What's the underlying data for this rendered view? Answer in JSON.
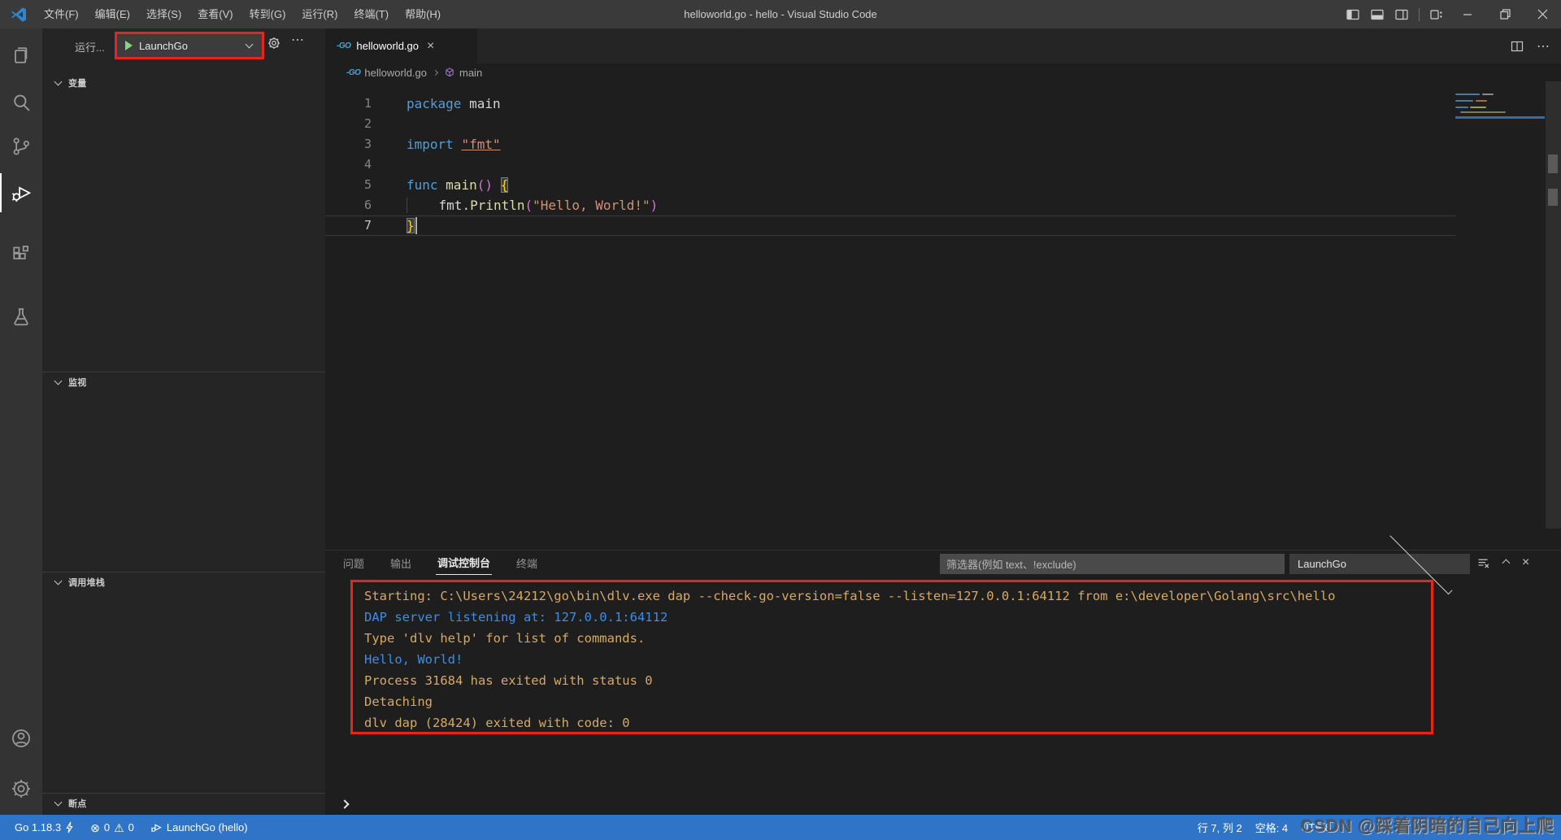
{
  "titlebar": {
    "title": "helloworld.go - hello - Visual Studio Code",
    "menus": [
      "文件(F)",
      "编辑(E)",
      "选择(S)",
      "查看(V)",
      "转到(G)",
      "运行(R)",
      "终端(T)",
      "帮助(H)"
    ]
  },
  "sidebar": {
    "run_label": "运行...",
    "launch_config": "LaunchGo",
    "sections": {
      "variables": "变量",
      "watch": "监视",
      "call_stack": "调用堆栈",
      "breakpoints": "断点"
    }
  },
  "editor": {
    "tab": "helloworld.go",
    "breadcrumb_file": "helloworld.go",
    "breadcrumb_symbol": "main",
    "lines": [
      {
        "n": "1",
        "tokens": [
          {
            "t": "package",
            "c": "kw"
          },
          {
            "t": " ",
            "c": "pl"
          },
          {
            "t": "main",
            "c": "pl"
          }
        ]
      },
      {
        "n": "2",
        "tokens": []
      },
      {
        "n": "3",
        "tokens": [
          {
            "t": "import",
            "c": "kw"
          },
          {
            "t": " ",
            "c": "pl"
          },
          {
            "t": "\"fmt\"",
            "c": "str link"
          }
        ]
      },
      {
        "n": "4",
        "tokens": []
      },
      {
        "n": "5",
        "tokens": [
          {
            "t": "func",
            "c": "kw"
          },
          {
            "t": " ",
            "c": "pl"
          },
          {
            "t": "main",
            "c": "fn"
          },
          {
            "t": "(",
            "c": "br1"
          },
          {
            "t": ")",
            "c": "br1"
          },
          {
            "t": " ",
            "c": "pl"
          },
          {
            "t": "{",
            "c": "brace match"
          }
        ]
      },
      {
        "n": "6",
        "tokens": [
          {
            "t": "    ",
            "c": "pl indent"
          },
          {
            "t": "fmt",
            "c": "pl"
          },
          {
            "t": ".",
            "c": "pl"
          },
          {
            "t": "Println",
            "c": "fn"
          },
          {
            "t": "(",
            "c": "br1"
          },
          {
            "t": "\"Hello, World!\"",
            "c": "str"
          },
          {
            "t": ")",
            "c": "br1"
          }
        ]
      },
      {
        "n": "7",
        "tokens": [
          {
            "t": "}",
            "c": "brace match"
          }
        ]
      }
    ]
  },
  "panel": {
    "tabs": [
      {
        "label": "问题",
        "active": false
      },
      {
        "label": "输出",
        "active": false
      },
      {
        "label": "调试控制台",
        "active": true
      },
      {
        "label": "终端",
        "active": false
      }
    ],
    "filter_placeholder": "筛选器(例如 text、!exclude)",
    "launch_config": "LaunchGo",
    "console_lines": [
      {
        "text": "Starting: C:\\Users\\24212\\go\\bin\\dlv.exe dap --check-go-version=false --listen=127.0.0.1:64112 from e:\\developer\\Golang\\src\\hello",
        "color": "yellow"
      },
      {
        "text": "DAP server listening at: 127.0.0.1:64112",
        "color": "blue"
      },
      {
        "text": "Type 'dlv help' for list of commands.",
        "color": "yellow"
      },
      {
        "text": "Hello, World!",
        "color": "blue"
      },
      {
        "text": "Process 31684 has exited with status 0",
        "color": "yellow"
      },
      {
        "text": "Detaching",
        "color": "yellow"
      },
      {
        "text": "dlv dap (28424) exited with code: 0",
        "color": "yellow"
      }
    ]
  },
  "status_bar": {
    "go_version": "Go 1.18.3",
    "errors": "0",
    "warnings": "0",
    "debug_target": "LaunchGo (hello)",
    "cursor": "行 7, 列 2",
    "indent": "空格: 4",
    "encoding": "UTF-8"
  },
  "watermark": "CSDN @踩着阴暗的自己向上爬",
  "colors": {
    "annotation_red": "#e8251d",
    "status_blue": "#2f74c6",
    "console_yellow": "#d7a965",
    "console_blue": "#3b8eea"
  }
}
